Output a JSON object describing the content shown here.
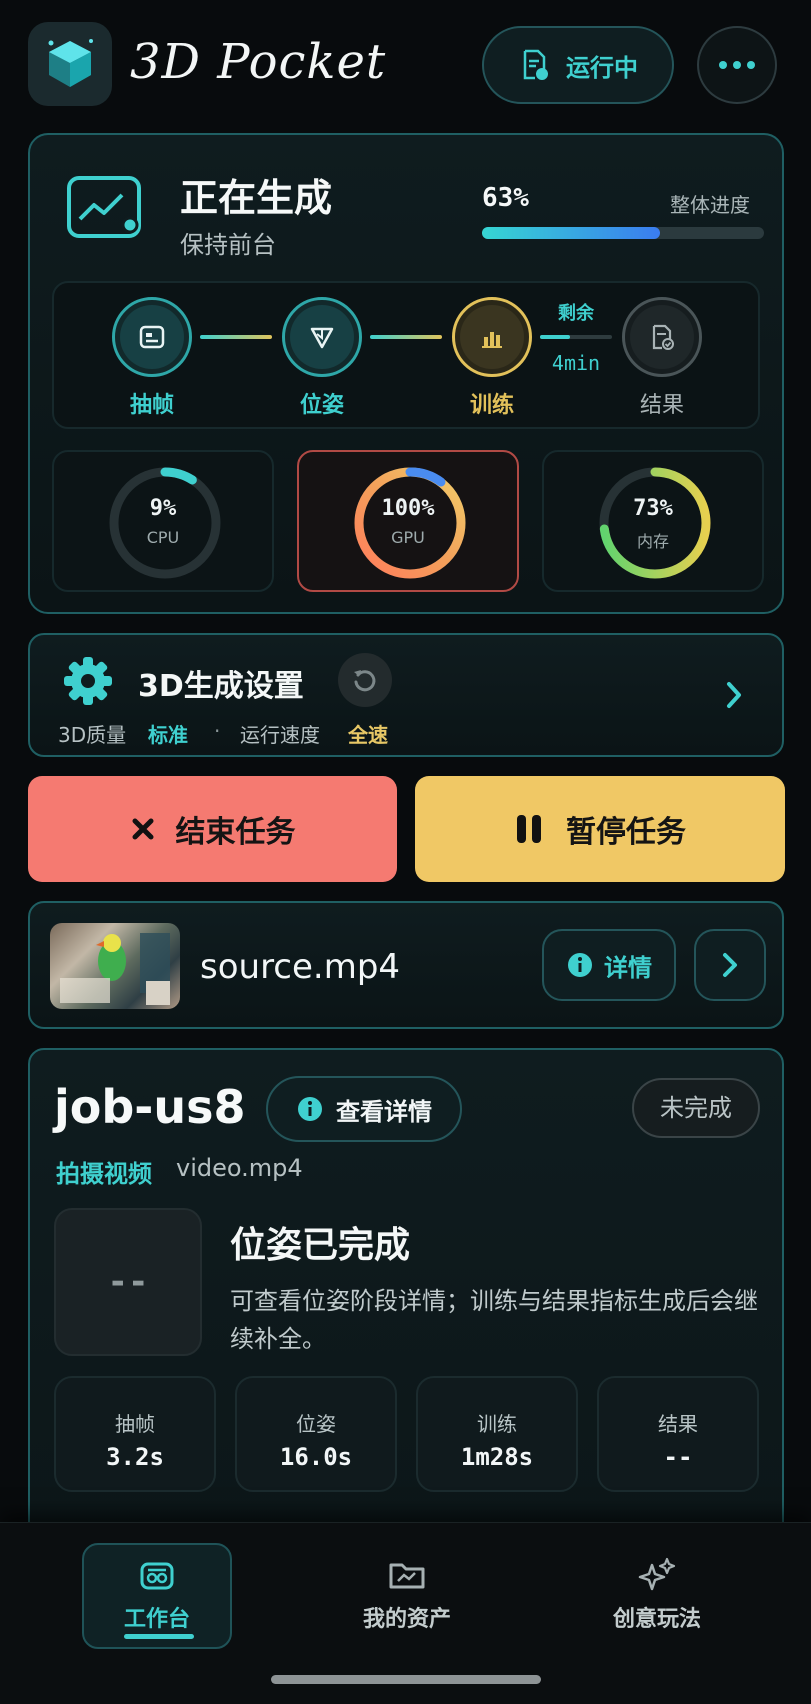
{
  "header": {
    "app_title": "3D Pocket",
    "status_button": "运行中"
  },
  "progress": {
    "title": "正在生成",
    "subtitle": "保持前台",
    "percent_label": "63%",
    "percent": 63,
    "overall_label": "整体进度",
    "stages": [
      {
        "label": "抽帧",
        "state": "done"
      },
      {
        "label": "位姿",
        "state": "done"
      },
      {
        "label": "训练",
        "state": "active"
      },
      {
        "label": "结果",
        "state": "pending"
      }
    ],
    "remaining_label": "剩余",
    "remaining_time": "4min"
  },
  "resources": [
    {
      "value": "9%",
      "label": "CPU",
      "percent": 9
    },
    {
      "value": "100%",
      "label": "GPU",
      "percent": 100
    },
    {
      "value": "73%",
      "label": "内存",
      "percent": 73
    }
  ],
  "settings": {
    "title": "3D生成设置",
    "quality_label": "3D质量",
    "quality_value": "标准",
    "separator": "·",
    "speed_label": "运行速度",
    "speed_value": "全速"
  },
  "actions": {
    "end_task": "结束任务",
    "pause_task": "暂停任务"
  },
  "source": {
    "filename": "source.mp4",
    "details_button": "详情"
  },
  "job": {
    "id": "job-us8",
    "view_details": "查看详情",
    "status_badge": "未完成",
    "type_label": "拍摄视频",
    "type_file": "video.mp4",
    "preview_placeholder": "--",
    "status_title": "位姿已完成",
    "status_desc": "可查看位姿阶段详情；训练与结果指标生成后会继续补全。",
    "stats": [
      {
        "label": "抽帧",
        "value": "3.2s"
      },
      {
        "label": "位姿",
        "value": "16.0s"
      },
      {
        "label": "训练",
        "value": "1m28s"
      },
      {
        "label": "结果",
        "value": "--"
      }
    ]
  },
  "nav": {
    "items": [
      {
        "label": "工作台",
        "active": true
      },
      {
        "label": "我的资产",
        "active": false
      },
      {
        "label": "创意玩法",
        "active": false
      }
    ]
  },
  "colors": {
    "accent": "#3fd0cf",
    "warning": "#e2c15a",
    "danger": "#f57a71",
    "pause": "#f0c865"
  }
}
